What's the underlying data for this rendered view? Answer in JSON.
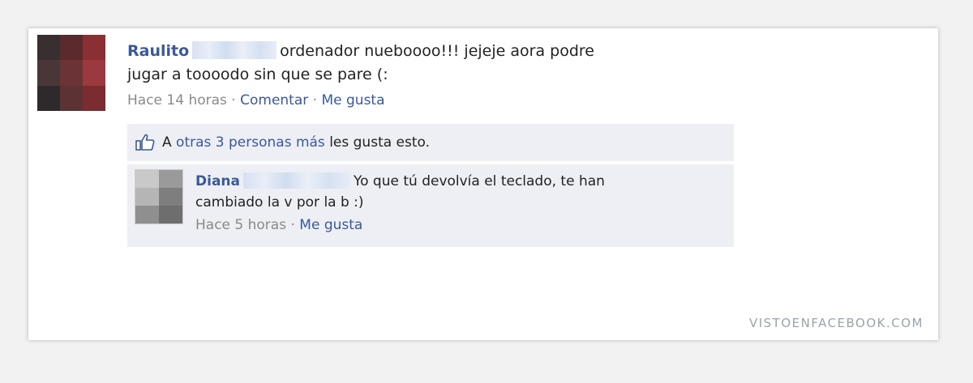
{
  "post": {
    "author": "Raulito",
    "text_line1": "ordenador nueboooo!!! jejeje aora podre",
    "text_line2": "jugar a toooodo sin que se pare (:",
    "time": "Hace 14 horas",
    "separator": " · ",
    "comment_label": "Comentar",
    "like_label": "Me gusta"
  },
  "likes": {
    "prefix": "A",
    "link_text": "otras 3 personas más",
    "suffix": "les gusta esto."
  },
  "comment": {
    "author": "Diana",
    "text_line1": "Yo que tú devolvía el teclado, te han",
    "text_line2": "cambiado la v por la b :)",
    "time": "Hace 5 horas",
    "separator": " · ",
    "like_label": "Me gusta"
  },
  "watermark": "VISTOENFACEBOOK.COM",
  "colors": {
    "link_blue": "#3b5998",
    "meta_gray": "#8a8a8a",
    "panel_bg": "#edeff4"
  }
}
